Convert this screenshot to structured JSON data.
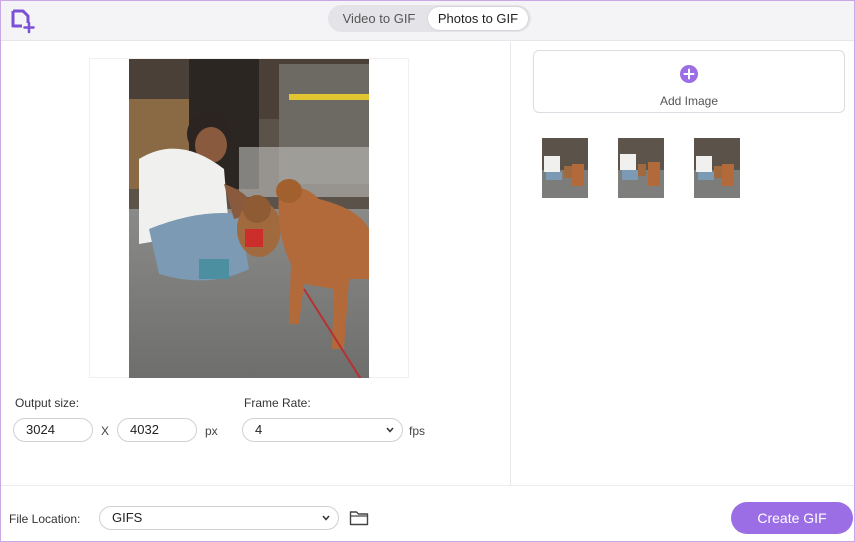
{
  "header": {
    "tabs": [
      {
        "label": "Video to GIF",
        "active": false
      },
      {
        "label": "Photos to GIF",
        "active": true
      }
    ]
  },
  "settings": {
    "output_size_label": "Output size:",
    "width": "3024",
    "height": "4032",
    "separator": "X",
    "unit": "px",
    "frame_rate_label": "Frame Rate:",
    "frame_rate": "4",
    "frame_rate_unit": "fps"
  },
  "images": {
    "add_label": "Add Image",
    "thumbnail_count": 3
  },
  "footer": {
    "file_location_label": "File Location:",
    "file_location": "GIFS",
    "create_label": "Create GIF"
  },
  "colors": {
    "accent": "#9b6ee6",
    "window_border": "#c9a8e6"
  },
  "icons": [
    "app-logo-icon",
    "plus-circle-icon",
    "chevron-down-icon",
    "folder-icon"
  ]
}
